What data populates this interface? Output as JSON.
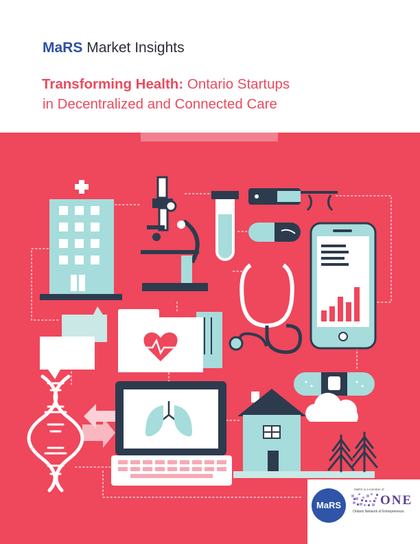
{
  "header": {
    "brand_name": "MaRS",
    "brand_suffix": "Market Insights",
    "title_lead": "Transforming Health:",
    "title_rest": "Ontario Startups",
    "title_line2": "in Decentralized and Connected Care"
  },
  "colors": {
    "accent": "#ea4a5e",
    "cover_red": "#ef475c",
    "band_light": "#f28090",
    "navy": "#2d3b4e",
    "teal": "#a6dcdb",
    "brand_blue": "#2f4fa0"
  },
  "illustration": {
    "icons": [
      "hospital-icon",
      "microscope-icon",
      "test-tube-icon",
      "smart-glasses-icon",
      "pill-icon",
      "smartphone-chart-icon",
      "chat-bubbles-icon",
      "medical-folder-heart-icon",
      "stethoscope-icon",
      "bandage-icon",
      "laptop-lungs-icon",
      "dna-icon",
      "house-icon",
      "pine-trees-icon",
      "cloud-icon"
    ]
  },
  "footer": {
    "mars_logo": "MaRS",
    "member_text": "MaRS is a member of",
    "one_logo": "ONE",
    "network_name": "Ontario Network of Entrepreneurs"
  }
}
